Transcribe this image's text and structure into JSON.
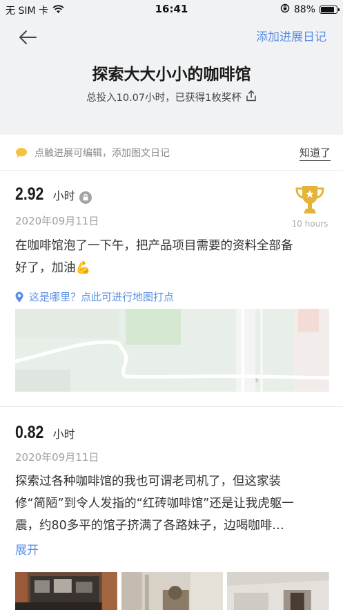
{
  "status_bar": {
    "carrier": "无 SIM 卡",
    "time": "16:41",
    "battery_percent": "88%",
    "battery_level": 0.88,
    "icons": [
      "wifi-icon",
      "orientation-lock-icon",
      "battery-icon"
    ]
  },
  "header": {
    "back_icon": "back-arrow-icon",
    "add_diary_label": "添加进展日记",
    "title": "探索大大小小的咖啡馆",
    "summary": "总投入10.07小时，已获得1枚奖杯",
    "share_icon": "share-icon"
  },
  "tip": {
    "icon": "chat-bubble-icon",
    "text": "点触进展可编辑，添加图文日记",
    "dismiss_label": "知道了"
  },
  "entries": [
    {
      "hours": "2.92",
      "unit": "小时",
      "private_icon": "lock-icon",
      "date": "2020年09月11日",
      "text_line1": "在咖啡馆泡了一下午，把产品项目需要的资料全部备",
      "text_line2": "好了，加油💪",
      "trophy_label": "10 hours",
      "location_prompt": "这是哪里？点此可进行地图打点",
      "map_marker": "5"
    },
    {
      "hours": "0.82",
      "unit": "小时",
      "date": "2020年09月11日",
      "text_line1": "探索过各种咖啡馆的我也可谓老司机了，但这家装",
      "text_line2": "修“简陋”到令人发指的“红砖咖啡馆”还是让我虎躯一",
      "text_line3": "震，约80多平的馆子挤满了各路妹子，边喝咖啡…",
      "expand_label": "展开"
    }
  ],
  "colors": {
    "accent": "#5a8ee6",
    "header_bg": "#f1f2f4",
    "trophy": "#e4b43a",
    "tip_icon": "#f5c342"
  }
}
